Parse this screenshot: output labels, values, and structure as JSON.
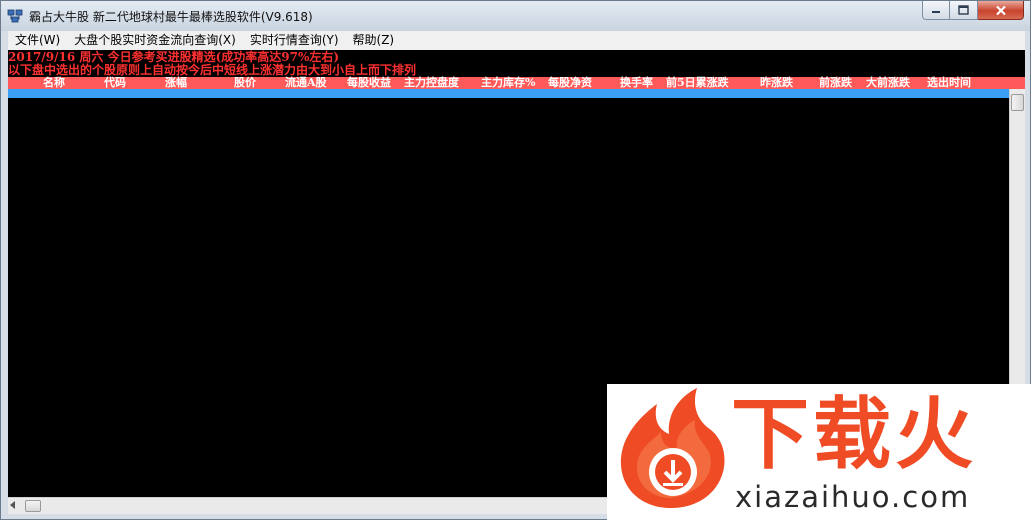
{
  "window": {
    "title": "霸占大牛股 新二代地球村最牛最棒选股软件(V9.618)"
  },
  "caption_buttons": [
    {
      "name": "minimize-button",
      "icon": "minimize-icon"
    },
    {
      "name": "maximize-button",
      "icon": "maximize-icon"
    },
    {
      "name": "close-button",
      "icon": "close-icon"
    }
  ],
  "menu": [
    {
      "label": "文件(W)"
    },
    {
      "label": "大盘个股实时资金流向查询(X)"
    },
    {
      "label": "实时行情查询(Y)"
    },
    {
      "label": "帮助(Z)"
    }
  ],
  "info": {
    "line1": "2017/9/16 周六  今日参考买进股精选(成功率高达97%左右)",
    "line2": "以下盘中选出的个股原则上自动按今后中短线上涨潜力由大到小自上而下排列"
  },
  "table": {
    "columns": [
      {
        "label": "名称"
      },
      {
        "label": "代码"
      },
      {
        "label": "涨幅"
      },
      {
        "label": "股价"
      },
      {
        "label": "流通A股"
      },
      {
        "label": "每股收益"
      },
      {
        "label": "主力控盘度"
      },
      {
        "label": "主力库存%"
      },
      {
        "label": "每股净资"
      },
      {
        "label": "换手率"
      },
      {
        "label": "前5日累涨跌"
      },
      {
        "label": "昨涨跌"
      },
      {
        "label": "前涨跌"
      },
      {
        "label": "大前涨跌"
      },
      {
        "label": "选出时间"
      }
    ]
  },
  "watermark": {
    "brand": "下载火",
    "domain": "xiazaihuo.com"
  },
  "colors": {
    "info_text": "#ff3030",
    "header_bg": "#ff5a5a",
    "selection": "#3aa0f5",
    "watermark": "#ef4b24"
  }
}
